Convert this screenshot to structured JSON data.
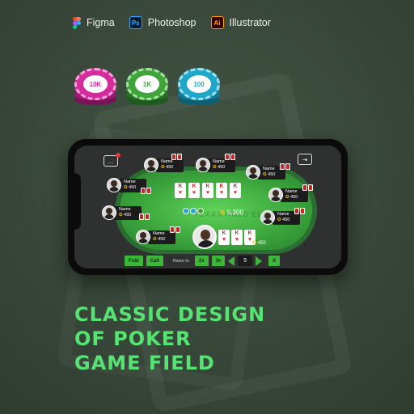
{
  "tools": [
    {
      "label": "Figma",
      "icon": "figma-icon"
    },
    {
      "label": "Photoshop",
      "icon": "photoshop-icon",
      "abbr": "Ps"
    },
    {
      "label": "Illustrator",
      "icon": "illustrator-icon",
      "abbr": "Ai"
    }
  ],
  "chips": [
    {
      "label": "10K",
      "color": "#d42c9c"
    },
    {
      "label": "1K",
      "color": "#3fa53b"
    },
    {
      "label": "100",
      "color": "#1fa6c9"
    }
  ],
  "game": {
    "watermark": "TEXAS HOLD'EM",
    "players": [
      {
        "name": "Name",
        "chips": "450"
      },
      {
        "name": "Name",
        "chips": "450"
      },
      {
        "name": "Name",
        "chips": "450"
      },
      {
        "name": "Name",
        "chips": "450"
      },
      {
        "name": "Name",
        "chips": "450"
      },
      {
        "name": "Name",
        "chips": "450"
      },
      {
        "name": "Name",
        "chips": "450"
      },
      {
        "name": "Name",
        "chips": "450"
      }
    ],
    "community_cards": [
      {
        "rank": "K",
        "suit": "♥"
      },
      {
        "rank": "K",
        "suit": "♥"
      },
      {
        "rank": "K",
        "suit": "♥"
      },
      {
        "rank": "K",
        "suit": "♥"
      },
      {
        "rank": "K",
        "suit": "♥"
      }
    ],
    "pot": "5,300",
    "hero": {
      "chips": "450",
      "cards": [
        {
          "rank": "K",
          "suit": "♥"
        },
        {
          "rank": "K",
          "suit": "♥"
        },
        {
          "rank": "K",
          "suit": "♥"
        }
      ]
    },
    "controls": {
      "fold": "Fold",
      "call": "Call",
      "raise_to": "Raise to",
      "x2": "2x",
      "x3": "3x",
      "value": "5",
      "x": "X"
    }
  },
  "headline": [
    "CLASSIC DESIGN",
    "OF POKER",
    "GAME FIELD"
  ],
  "colors": {
    "background": "#3a4a3d",
    "felt": "#4cc24a",
    "accent": "#57e373"
  }
}
